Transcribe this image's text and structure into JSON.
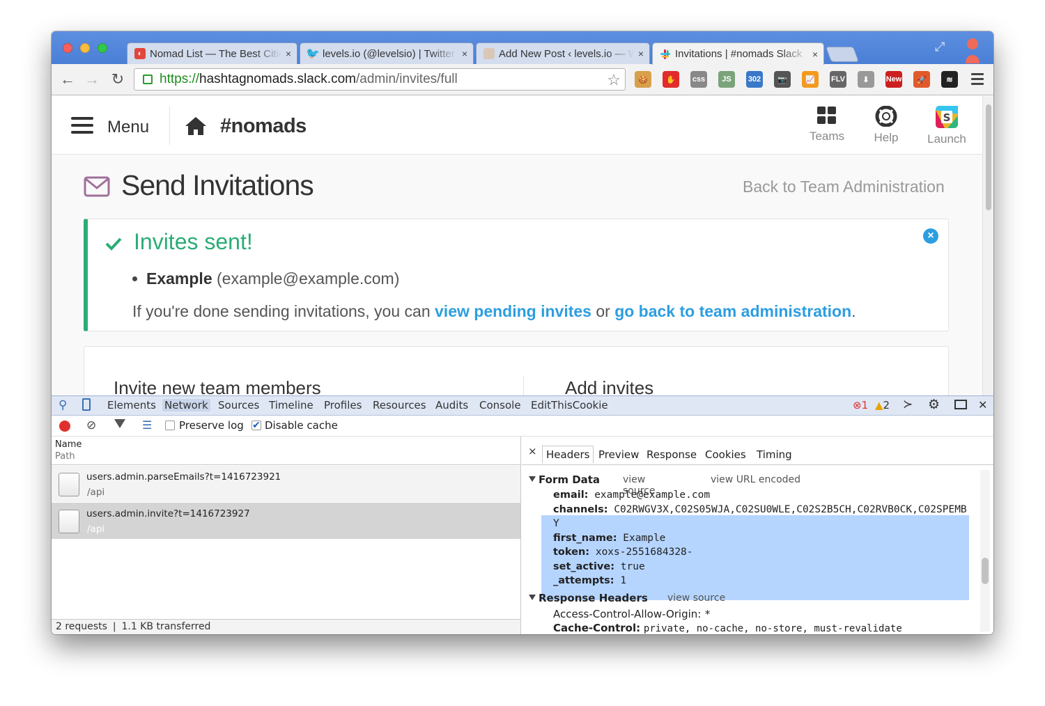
{
  "browser": {
    "tabs": [
      {
        "title": "Nomad List — The Best Cities to Live and Work Remotely",
        "favicon": "nomadlist-icon",
        "color": "#e2453b"
      },
      {
        "title": "levels.io (@levelsio) | Twitter",
        "favicon": "twitter-icon",
        "color": "#4ba3e8"
      },
      {
        "title": "Add New Post ‹ levels.io — WordPress",
        "favicon": "avatar-icon",
        "color": "#999999"
      },
      {
        "title": "Invitations | #nomads Slack",
        "favicon": "slack-icon",
        "color": "#e01e5a"
      }
    ],
    "close_glyph": "×",
    "url": {
      "scheme": "https://",
      "host": "hashtagnomads.slack.com",
      "path": "/admin/invites/full"
    },
    "extensions": [
      {
        "name": "cookie-extension-icon",
        "label": "🍪",
        "color": "#d8a04a"
      },
      {
        "name": "adblock-extension-icon",
        "label": "✋",
        "color": "#e22b2b"
      },
      {
        "name": "css-extension-icon",
        "label": "css",
        "color": "#888888"
      },
      {
        "name": "js-extension-icon",
        "label": "JS",
        "color": "#7aa37a"
      },
      {
        "name": "redirect-extension-icon",
        "label": "302",
        "color": "#3a78c8"
      },
      {
        "name": "camera-extension-icon",
        "label": "📷",
        "color": "#555555"
      },
      {
        "name": "chart-extension-icon",
        "label": "📈",
        "color": "#f39a1e"
      },
      {
        "name": "flv-extension-icon",
        "label": "FLV",
        "color": "#666666"
      },
      {
        "name": "download-extension-icon",
        "label": "⬇",
        "color": "#999999"
      },
      {
        "name": "new-extension-icon",
        "label": "New",
        "color": "#cc1f1f"
      },
      {
        "name": "rocket-extension-icon",
        "label": "🚀",
        "color": "#e15a2b"
      },
      {
        "name": "layers-extension-icon",
        "label": "≋",
        "color": "#222222"
      }
    ]
  },
  "slack": {
    "menu_label": "Menu",
    "team_name": "#nomads",
    "nav": [
      {
        "label": "Teams",
        "icon": "grid-icon"
      },
      {
        "label": "Help",
        "icon": "lifebuoy-icon"
      },
      {
        "label": "Launch",
        "icon": "slack-logo-icon"
      }
    ],
    "page_title": "Send Invitations",
    "back_link": "Back to Team Administration",
    "alert": {
      "title": "Invites sent!",
      "invitee_name": "Example",
      "invitee_email": "(example@example.com)",
      "text_before": "If you're done sending invitations, you can ",
      "link1": "view pending invites",
      "text_mid": " or ",
      "link2": "go back to team administration",
      "text_after": ".",
      "accent": "#2bac76",
      "close_glyph": "×"
    },
    "card": {
      "left_heading": "Invite new team members",
      "right_heading": "Add invites"
    }
  },
  "devtools": {
    "tabs": [
      "Elements",
      "Network",
      "Sources",
      "Timeline",
      "Profiles",
      "Resources",
      "Audits",
      "Console",
      "EditThisCookie"
    ],
    "selected_tab": "Network",
    "errors": "1",
    "warnings": "2",
    "preserve_log": "Preserve log",
    "disable_cache": "Disable cache",
    "col_name": "Name",
    "col_path": "Path",
    "requests": [
      {
        "name": "users.admin.parseEmails?t=1416723921",
        "path": "/api",
        "selected": false
      },
      {
        "name": "users.admin.invite?t=1416723927",
        "path": "/api",
        "selected": true
      }
    ],
    "status": "2 requests ❘ 1.1 KB transferred",
    "detail_close": "×",
    "detail_tabs": [
      "Headers",
      "Preview",
      "Response",
      "Cookies",
      "Timing"
    ],
    "form_data": {
      "title": "Form Data",
      "view_source": "view source",
      "view_url_encoded": "view URL encoded",
      "fields": [
        {
          "key": "email:",
          "value": "example@example.com"
        },
        {
          "key": "channels:",
          "value": "C02RWGV3X,C02S05WJA,C02SU0WLE,C02S2B5CH,C02RVB0CK,C02SPEMB"
        },
        {
          "key": "",
          "value": "Y"
        },
        {
          "key": "first_name:",
          "value": "Example"
        },
        {
          "key": "token:",
          "value": "xoxs-2551684328-"
        },
        {
          "key": "set_active:",
          "value": "true"
        },
        {
          "key": "_attempts:",
          "value": "1"
        }
      ]
    },
    "response_headers": {
      "title": "Response Headers",
      "view_source": "view source",
      "fields": [
        {
          "key": "Access-Control-Allow-Origin:",
          "value": "*"
        },
        {
          "key": "Cache-Control:",
          "value": "private, no-cache, no-store, must-revalidate"
        }
      ]
    }
  }
}
